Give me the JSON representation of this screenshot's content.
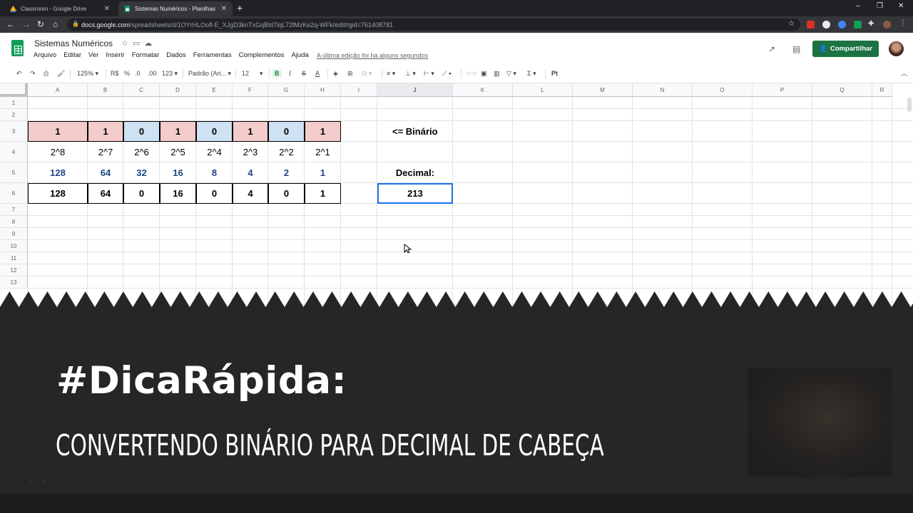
{
  "browser": {
    "tabs": [
      {
        "label": "Classroom - Google Drive",
        "active": false
      },
      {
        "label": "Sistemas Numéricos - Planilhas G",
        "active": true
      }
    ],
    "url_host": "docs.google.com",
    "url_path": "/spreadsheets/d/1OYrHLOofl-E_XJgD3knTxGqBld7lqL72lMzKe2q-WFk/edit#gid=761408781"
  },
  "sheet": {
    "title": "Sistemas Numéricos",
    "menu": [
      "Arquivo",
      "Editar",
      "Ver",
      "Inserir",
      "Formatar",
      "Dados",
      "Ferramentas",
      "Complementos",
      "Ajuda"
    ],
    "last_edit": "A última edição foi há alguns segundos",
    "share_label": "Compartilhar",
    "accent_color": "#1a7340"
  },
  "toolbar": {
    "zoom": "125%",
    "currency": "R$",
    "percent": "%",
    "dec_less": ".0",
    "dec_more": ".00",
    "format_more": "123",
    "font": "Padrão (Ari...",
    "font_size": "12",
    "bold": "B",
    "italic": "I",
    "strike": "S",
    "text_color": "A"
  },
  "grid": {
    "columns": [
      "A",
      "B",
      "C",
      "D",
      "E",
      "F",
      "G",
      "H",
      "I",
      "J",
      "K",
      "L",
      "M",
      "N",
      "O",
      "P",
      "Q",
      "R"
    ],
    "rows": [
      "1",
      "2",
      "3",
      "4",
      "5",
      "6",
      "7",
      "8",
      "9",
      "10",
      "11",
      "12",
      "13"
    ],
    "binary_digits": [
      "1",
      "1",
      "0",
      "1",
      "0",
      "1",
      "0",
      "1"
    ],
    "binary_label": "<= Binário",
    "powers": [
      "2^8",
      "2^7",
      "2^6",
      "2^5",
      "2^4",
      "2^3",
      "2^2",
      "2^1"
    ],
    "weights": [
      "128",
      "64",
      "32",
      "16",
      "8",
      "4",
      "2",
      "1"
    ],
    "decimal_label": "Decimal:",
    "products": [
      "128",
      "64",
      "0",
      "16",
      "0",
      "4",
      "0",
      "1"
    ],
    "decimal_result": "213",
    "highlight_one": "#f4cccc",
    "highlight_zero": "#cfe2f3"
  },
  "banner": {
    "hashtag": "#DicaRápida:",
    "subtitle": "CONVERTENDO BINÁRIO PARA DECIMAL DE CABEÇA"
  }
}
